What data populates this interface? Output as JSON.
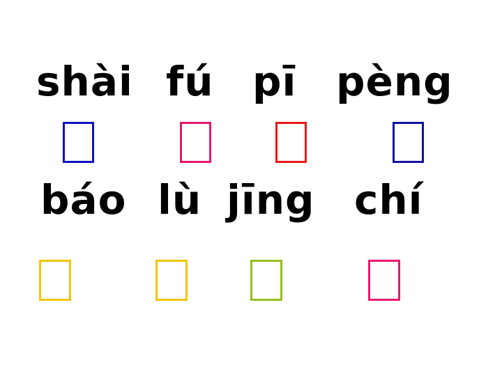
{
  "row1": {
    "words": [
      {
        "pinyin": "shài",
        "box_color": "#1010c0"
      },
      {
        "pinyin": "fú",
        "box_color": "#e8196e"
      },
      {
        "pinyin": "pī",
        "box_color": "#e81818"
      },
      {
        "pinyin": "pèng",
        "box_color": "#1010a0"
      }
    ]
  },
  "row2": {
    "words": [
      {
        "pinyin": "báo",
        "box_color": "#f2c400"
      },
      {
        "pinyin": "lù",
        "box_color": "#f2c400"
      },
      {
        "pinyin": "jīng",
        "box_color": "#94c11f"
      },
      {
        "pinyin": "chí",
        "box_color": "#e8196e"
      }
    ]
  }
}
